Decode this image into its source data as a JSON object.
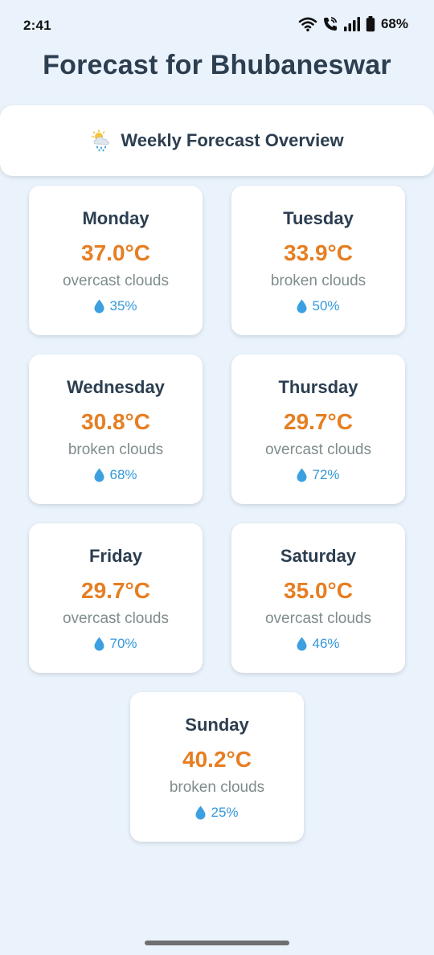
{
  "status_bar": {
    "time": "2:41",
    "battery": "68%",
    "icons": [
      "wifi-icon",
      "wifi-calling-icon",
      "signal-icon",
      "battery-icon"
    ]
  },
  "page": {
    "title": "Forecast for Bhubaneswar"
  },
  "overview": {
    "title": "Weekly Forecast Overview",
    "icon": "sun-behind-rain-cloud-icon"
  },
  "days": [
    {
      "name": "Monday",
      "temp": "37.0°C",
      "desc": "overcast clouds",
      "humidity": "35%"
    },
    {
      "name": "Tuesday",
      "temp": "33.9°C",
      "desc": "broken clouds",
      "humidity": "50%"
    },
    {
      "name": "Wednesday",
      "temp": "30.8°C",
      "desc": "broken clouds",
      "humidity": "68%"
    },
    {
      "name": "Thursday",
      "temp": "29.7°C",
      "desc": "overcast clouds",
      "humidity": "72%"
    },
    {
      "name": "Friday",
      "temp": "29.7°C",
      "desc": "overcast clouds",
      "humidity": "70%"
    },
    {
      "name": "Saturday",
      "temp": "35.0°C",
      "desc": "overcast clouds",
      "humidity": "46%"
    },
    {
      "name": "Sunday",
      "temp": "40.2°C",
      "desc": "broken clouds",
      "humidity": "25%"
    }
  ],
  "colors": {
    "background": "#eaf3fc",
    "title": "#2c3e50",
    "temperature": "#e67e22",
    "description": "#7f8c8d",
    "humidity": "#3498db"
  }
}
